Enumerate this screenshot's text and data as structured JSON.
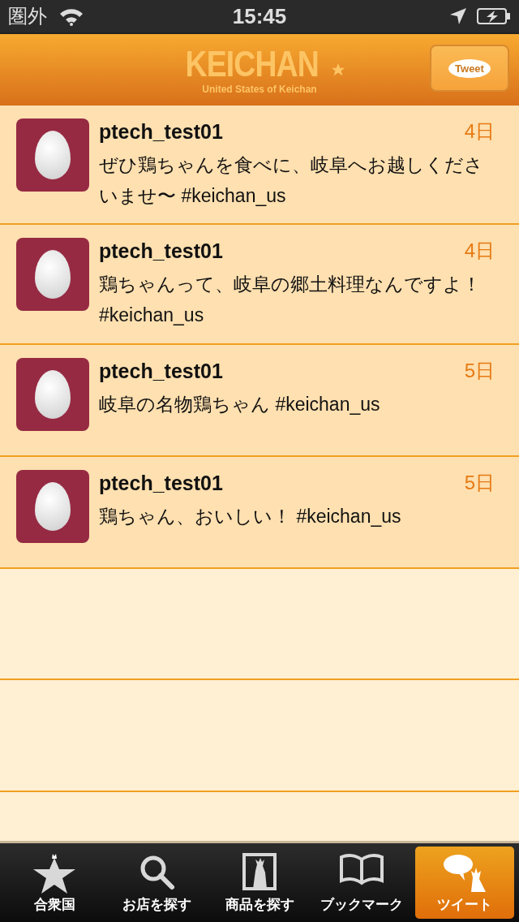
{
  "status_bar": {
    "carrier": "圏外",
    "time": "15:45"
  },
  "header": {
    "logo": "KEICHAN",
    "logo_subtitle": "United States of Keichan",
    "tweet_button": "Tweet"
  },
  "tweets": [
    {
      "user": "ptech_test01",
      "age": "4日",
      "text": "ぜひ鶏ちゃんを食べに、岐阜へお越しくださいませ〜 #keichan_us"
    },
    {
      "user": "ptech_test01",
      "age": "4日",
      "text": "鶏ちゃんって、岐阜の郷土料理なんですよ！ #keichan_us"
    },
    {
      "user": "ptech_test01",
      "age": "5日",
      "text": "岐阜の名物鶏ちゃん #keichan_us"
    },
    {
      "user": "ptech_test01",
      "age": "5日",
      "text": "鶏ちゃん、おいしい！ #keichan_us"
    }
  ],
  "tab_bar": [
    {
      "kind": "star",
      "label": "合衆国",
      "selected": false
    },
    {
      "kind": "search",
      "label": "お店を探す",
      "selected": false
    },
    {
      "kind": "product",
      "label": "商品を探す",
      "selected": false
    },
    {
      "kind": "book",
      "label": "ブックマーク",
      "selected": false
    },
    {
      "kind": "tweet",
      "label": "ツイート",
      "selected": true
    }
  ]
}
